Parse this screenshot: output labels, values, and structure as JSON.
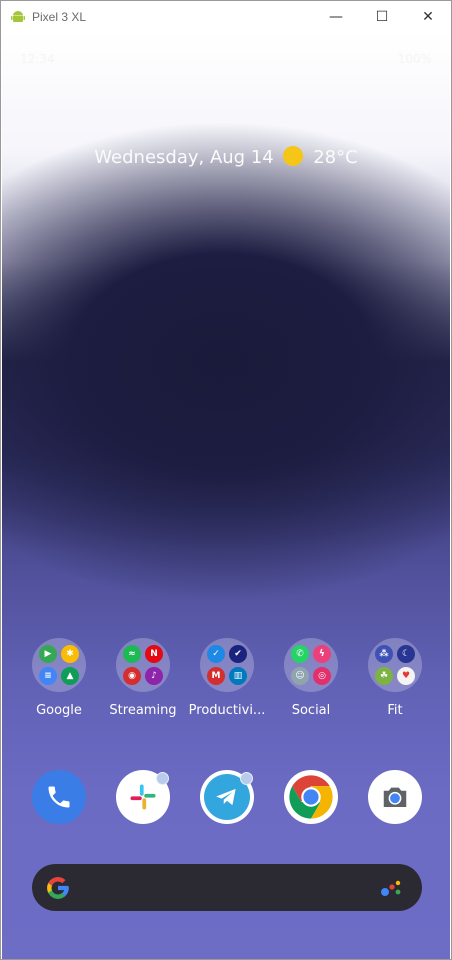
{
  "window": {
    "title": "Pixel 3 XL",
    "controls": {
      "minimize": "—",
      "maximize": "☐",
      "close": "✕"
    }
  },
  "status_bar": {
    "time": "12:34",
    "right": "100%"
  },
  "at_a_glance": {
    "date": "Wednesday, Aug 14",
    "weather": "28°C"
  },
  "folders": [
    {
      "label": "Google",
      "icons": [
        "play-icon",
        "photos-icon",
        "docs-icon",
        "drive-icon"
      ]
    },
    {
      "label": "Streaming",
      "icons": [
        "spotify-icon",
        "netflix-icon",
        "podcast-icon",
        "music-icon"
      ]
    },
    {
      "label": "Productivi...",
      "icons": [
        "todo-icon",
        "tasks-icon",
        "gmail-icon",
        "trello-icon"
      ]
    },
    {
      "label": "Social",
      "icons": [
        "whatsapp-icon",
        "messenger-icon",
        "chat-icon",
        "instagram-icon"
      ]
    },
    {
      "label": "Fit",
      "icons": [
        "fitbit-icon",
        "sleep-icon",
        "run-icon",
        "fit-icon"
      ]
    }
  ],
  "dock": [
    "phone-icon",
    "slack-icon",
    "telegram-icon",
    "chrome-icon",
    "camera-icon"
  ],
  "search_bar": {
    "logo": "google-g-icon",
    "assistant": "assistant-icon"
  }
}
